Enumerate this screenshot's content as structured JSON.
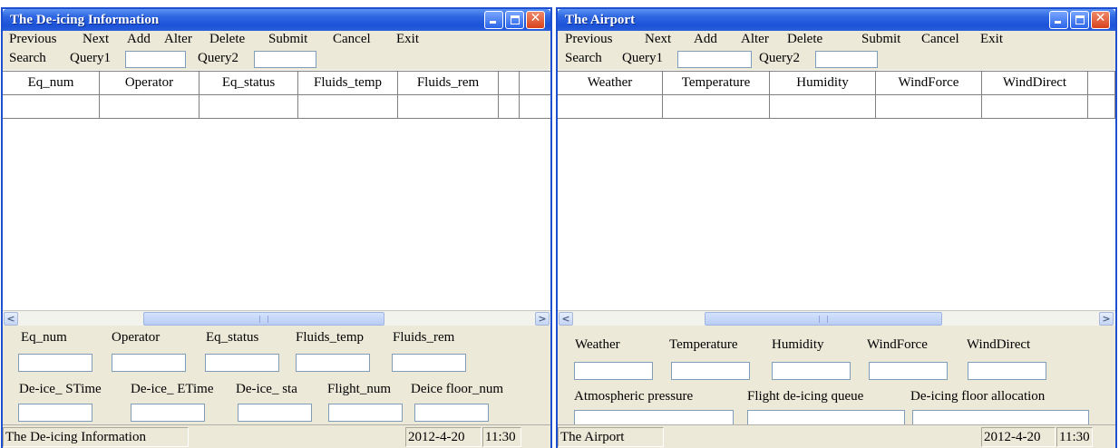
{
  "windows": [
    {
      "title": "The De-icing Information",
      "menu": [
        "Previous",
        "Next",
        "Add",
        "Alter",
        "Delete",
        "Submit",
        "Cancel",
        "Exit"
      ],
      "search": {
        "label": "Search",
        "query1_label": "Query1",
        "query1_value": "",
        "query2_label": "Query2",
        "query2_value": ""
      },
      "grid": {
        "columns": [
          "Eq_num",
          "Operator",
          "Eq_status",
          "Fluids_temp",
          "Fluids_rem",
          ""
        ],
        "rows": [
          [
            "",
            "",
            "",
            "",
            "",
            ""
          ]
        ]
      },
      "form": {
        "row1_labels": [
          "Eq_num",
          "Operator",
          "Eq_status",
          "Fluids_temp",
          "Fluids_rem"
        ],
        "row1_values": [
          "",
          "",
          "",
          "",
          ""
        ],
        "row2_labels": [
          "De-ice_ STime",
          "De-ice_ ETime",
          "De-ice_ sta",
          "Flight_num",
          "Deice floor_num"
        ],
        "row2_values": [
          "",
          "",
          "",
          "",
          ""
        ]
      },
      "status": {
        "text": "The De-icing Information",
        "date": "2012-4-20",
        "time": "11:30"
      }
    },
    {
      "title": "The Airport",
      "menu": [
        "Previous",
        "Next",
        "Add",
        "Alter",
        "Delete",
        "Submit",
        "Cancel",
        "Exit"
      ],
      "search": {
        "label": "Search",
        "query1_label": "Query1",
        "query1_value": "",
        "query2_label": "Query2",
        "query2_value": ""
      },
      "grid": {
        "columns": [
          "Weather",
          "Temperature",
          "Humidity",
          "WindForce",
          "WindDirect",
          ""
        ],
        "rows": [
          [
            "",
            "",
            "",
            "",
            "",
            ""
          ]
        ]
      },
      "form": {
        "row1_labels": [
          "Weather",
          "Temperature",
          "Humidity",
          "WindForce",
          "WindDirect"
        ],
        "row1_values": [
          "",
          "",
          "",
          "",
          ""
        ],
        "row2_labels": [
          "Atmospheric pressure",
          "Flight de-icing queue",
          "De-icing floor allocation"
        ],
        "row2_values": [
          "",
          "",
          ""
        ]
      },
      "status": {
        "text": "The Airport",
        "date": "2012-4-20",
        "time": "11:30"
      }
    }
  ],
  "icons": {
    "minimize": "minimize-icon",
    "maximize": "maximize-icon",
    "close": "close-icon",
    "scroll_left": "scroll-left-icon",
    "scroll_right": "scroll-right-icon"
  },
  "colors": {
    "title_bar": "#2e66e2",
    "face": "#ece9d8",
    "field_border": "#7f9db9",
    "grid_line": "#808080"
  }
}
